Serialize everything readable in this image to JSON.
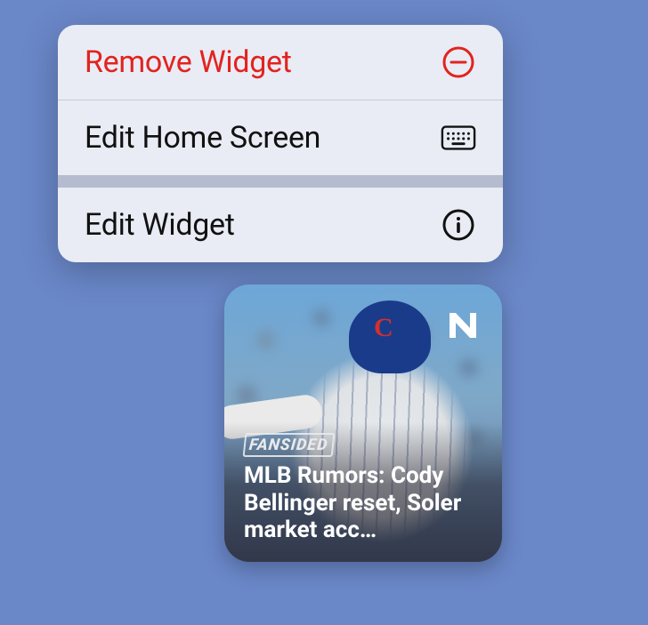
{
  "context_menu": {
    "items": [
      {
        "label": "Remove Widget",
        "icon": "minus-circle-icon",
        "destructive": true
      },
      {
        "label": "Edit Home Screen",
        "icon": "keyboard-icon",
        "destructive": false
      },
      {
        "label": "Edit Widget",
        "icon": "info-circle-icon",
        "destructive": false
      }
    ]
  },
  "widget": {
    "app_icon": "news-icon",
    "source": "FANSIDED",
    "headline": "MLB Rumors: Cody Bellinger reset, Soler market acc…",
    "image_subject": "baseball-player-cubs"
  },
  "colors": {
    "background": "#6a87c8",
    "destructive": "#e2231f",
    "menu_bg": "#eef0f6"
  }
}
